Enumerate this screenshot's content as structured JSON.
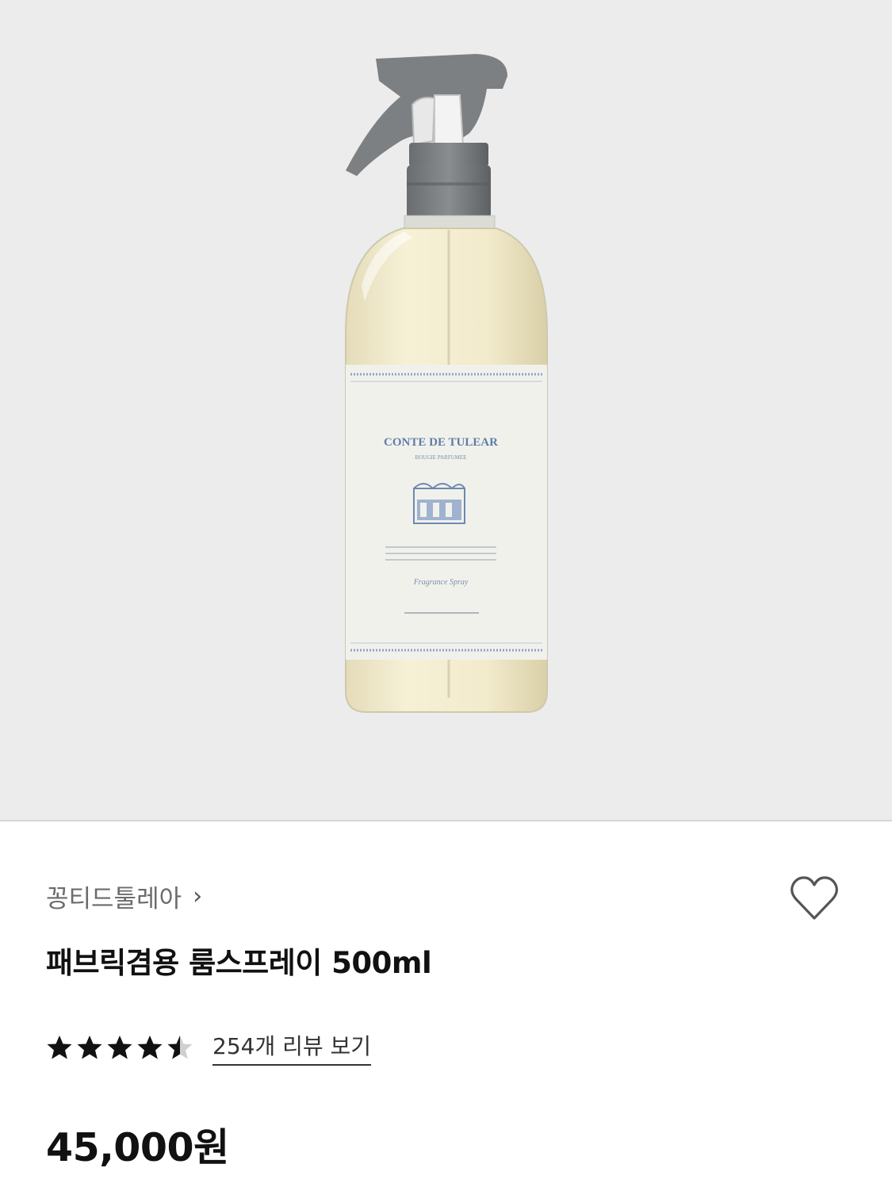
{
  "product": {
    "label_brand": "CONTE DE TULEAR",
    "label_sub": "BOUGIE PARFUMEE",
    "label_script": "Fragrance Spray",
    "brand_name": "꽁티드툴레아",
    "brand_chevron": "›",
    "title": "패브릭겸용 룸스프레이 500ml",
    "rating": 4.5,
    "rating_max": 5,
    "review_link": "254개 리뷰 보기",
    "price": "45,000원"
  },
  "colors": {
    "hero_bg": "#ececec",
    "star": "#111111",
    "star_empty": "#cfcfcf",
    "heart_outline": "#555555"
  },
  "icons": {
    "wishlist": "heart-outline-icon",
    "brand_link": "chevron-right-icon",
    "rating": "star-icon"
  }
}
